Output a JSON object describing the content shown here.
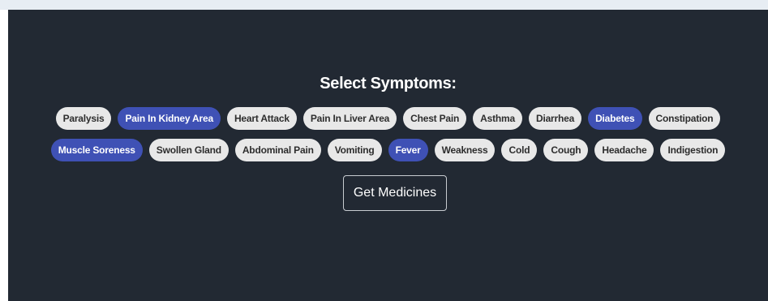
{
  "heading": "Select Symptoms:",
  "symptoms_row1": [
    {
      "label": "Paralysis",
      "selected": false
    },
    {
      "label": "Pain In Kidney Area",
      "selected": true
    },
    {
      "label": "Heart Attack",
      "selected": false
    },
    {
      "label": "Pain In Liver Area",
      "selected": false
    },
    {
      "label": "Chest Pain",
      "selected": false
    },
    {
      "label": "Asthma",
      "selected": false
    },
    {
      "label": "Diarrhea",
      "selected": false
    },
    {
      "label": "Diabetes",
      "selected": true
    },
    {
      "label": "Constipation",
      "selected": false
    }
  ],
  "symptoms_row2": [
    {
      "label": "Muscle Soreness",
      "selected": true
    },
    {
      "label": "Swollen Gland",
      "selected": false
    },
    {
      "label": "Abdominal Pain",
      "selected": false
    },
    {
      "label": "Vomiting",
      "selected": false
    },
    {
      "label": "Fever",
      "selected": true
    },
    {
      "label": "Weakness",
      "selected": false
    },
    {
      "label": "Cold",
      "selected": false
    },
    {
      "label": "Cough",
      "selected": false
    },
    {
      "label": "Headache",
      "selected": false
    },
    {
      "label": "Indigestion",
      "selected": false
    }
  ],
  "submit_label": "Get Medicines",
  "colors": {
    "panel_bg": "#222933",
    "chip_bg": "#e8e8e8",
    "chip_selected_bg": "#3f51b5",
    "chip_text": "#2d2d2d",
    "chip_selected_text": "#ffffff",
    "top_strip": "#e7edf3"
  }
}
